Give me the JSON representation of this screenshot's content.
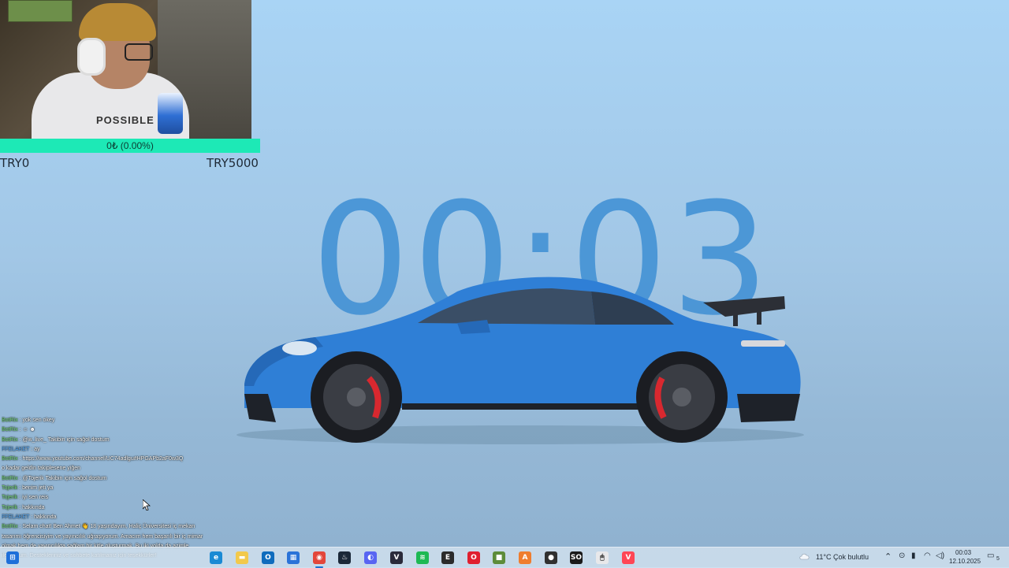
{
  "webcam": {
    "hoodie_text": "POSSIBLE"
  },
  "donation": {
    "progress_label": "0₺ (0.00%)",
    "progress_fraction": 0.0,
    "min_label": "TRY0",
    "max_label": "TRY5000",
    "bar_color": "#1de9b6"
  },
  "countdown": {
    "time": "00:03"
  },
  "chat": {
    "lines": [
      {
        "user": "BotRix",
        "text": ": yok sen okey"
      },
      {
        "user": "BotRix",
        "text": ": ☺ ☻"
      },
      {
        "user": "BotRix",
        "text": ": @w_live_ Takibin için sağol dostum"
      },
      {
        "user": "FFELAKET",
        "text": ": ay"
      },
      {
        "user": "BotRix",
        "text": ": https://www.youtube.com/channel/UC74adlgu#HPGAPb2aF0w3Q"
      },
      {
        "user": "",
        "text": "o kadar geldin takiplesene yiğen"
      },
      {
        "user": "BotRix",
        "text": ": @Tojerik Takibin için sağol dostum"
      },
      {
        "user": "Tojerik",
        "text": ": benim jeti ya"
      },
      {
        "user": "Tojerik",
        "text": ": iyi sen reis"
      },
      {
        "user": "Tojerik",
        "text": ": hakkında"
      },
      {
        "user": "FFELAKET",
        "text": ": hakkında"
      },
      {
        "user": "BotRix",
        "text": ": Selam chat! Ben Ahmet 👋 18 yaşındayım, Haliç Üniversitesi iç mekan tasarımı öğrencisiyim ve yayıncılık uğraşıyorum. Amacım hem başarılı bir iç mimar olmak hem de yayıncılıkta sağlam bir kitle oluşturmak. Bu iki yolda da azimle ilerliyorum. Destekleriniz ve sohbete katılmanız için teşekkürler!"
      }
    ]
  },
  "taskbar": {
    "icons": [
      {
        "name": "start-icon",
        "color": "#1e6fd9",
        "glyph": "⊞"
      },
      {
        "name": "edge-icon",
        "color": "#1a8ad4",
        "glyph": "e"
      },
      {
        "name": "file-explorer-icon",
        "color": "#f2c94c",
        "glyph": "▬"
      },
      {
        "name": "outlook-icon",
        "color": "#0f6cbd",
        "glyph": "O"
      },
      {
        "name": "store-icon",
        "color": "#2a73d8",
        "glyph": "▦"
      },
      {
        "name": "chrome-icon",
        "color": "#e3463a",
        "glyph": "◉"
      },
      {
        "name": "steam-icon",
        "color": "#1b2838",
        "glyph": "♨"
      },
      {
        "name": "discord-icon",
        "color": "#5865f2",
        "glyph": "◐"
      },
      {
        "name": "vegas-icon",
        "color": "#2a2a3a",
        "glyph": "V"
      },
      {
        "name": "spotify-icon",
        "color": "#1db954",
        "glyph": "≋"
      },
      {
        "name": "epic-games-icon",
        "color": "#2b2b2b",
        "glyph": "E"
      },
      {
        "name": "opera-icon",
        "color": "#e0202f",
        "glyph": "O"
      },
      {
        "name": "minecraft-icon",
        "color": "#5d8c3a",
        "glyph": "■"
      },
      {
        "name": "app-a-icon",
        "color": "#ef7d2e",
        "glyph": "A"
      },
      {
        "name": "obs-icon",
        "color": "#303030",
        "glyph": "●"
      },
      {
        "name": "app-so-icon",
        "color": "#1a1a1a",
        "glyph": "SO"
      },
      {
        "name": "mouse-app-icon",
        "color": "#e8e8ea",
        "glyph": "🖱"
      },
      {
        "name": "valorant-icon",
        "color": "#ff4655",
        "glyph": "V"
      }
    ],
    "weather": "11°C  Çok bulutlu",
    "time": "00:03",
    "date": "12.10.2025",
    "notification_count": "5"
  }
}
